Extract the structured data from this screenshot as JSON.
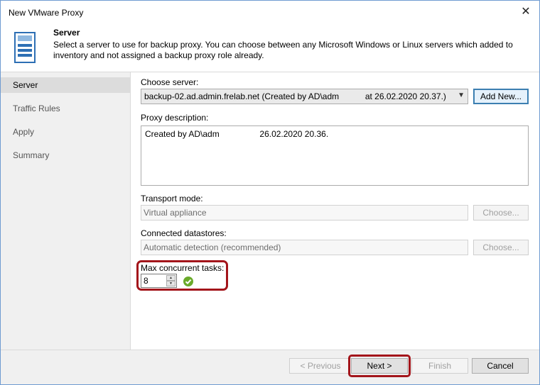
{
  "window": {
    "title": "New VMware Proxy",
    "close_glyph": "✕"
  },
  "header": {
    "icon": "server-icon",
    "title": "Server",
    "description": "Select a server to use for backup proxy. You can choose between any Microsoft Windows or Linux servers which added to inventory and not assigned a backup proxy role already."
  },
  "sidebar": {
    "items": [
      {
        "label": "Server",
        "active": true
      },
      {
        "label": "Traffic Rules",
        "active": false
      },
      {
        "label": "Apply",
        "active": false
      },
      {
        "label": "Summary",
        "active": false
      }
    ]
  },
  "form": {
    "choose_server_label": "Choose server:",
    "server_value": "backup-02.ad.admin.frelab.net (Created by AD\\adm           at 26.02.2020 20.37.)",
    "add_new_label": "Add New...",
    "proxy_description_label": "Proxy description:",
    "proxy_description_value": "Created by AD\\adm                 26.02.2020 20.36.",
    "transport_mode_label": "Transport mode:",
    "transport_mode_value": "Virtual appliance",
    "transport_choose_label": "Choose...",
    "datastores_label": "Connected datastores:",
    "datastores_value": "Automatic detection (recommended)",
    "datastores_choose_label": "Choose...",
    "max_tasks_label": "Max concurrent tasks:",
    "max_tasks_value": "8"
  },
  "footer": {
    "previous_label": "< Previous",
    "next_label": "Next >",
    "finish_label": "Finish",
    "cancel_label": "Cancel"
  },
  "colors": {
    "highlight": "#a3151b",
    "accent": "#3c7fb1",
    "ok": "#6aaa2a"
  }
}
